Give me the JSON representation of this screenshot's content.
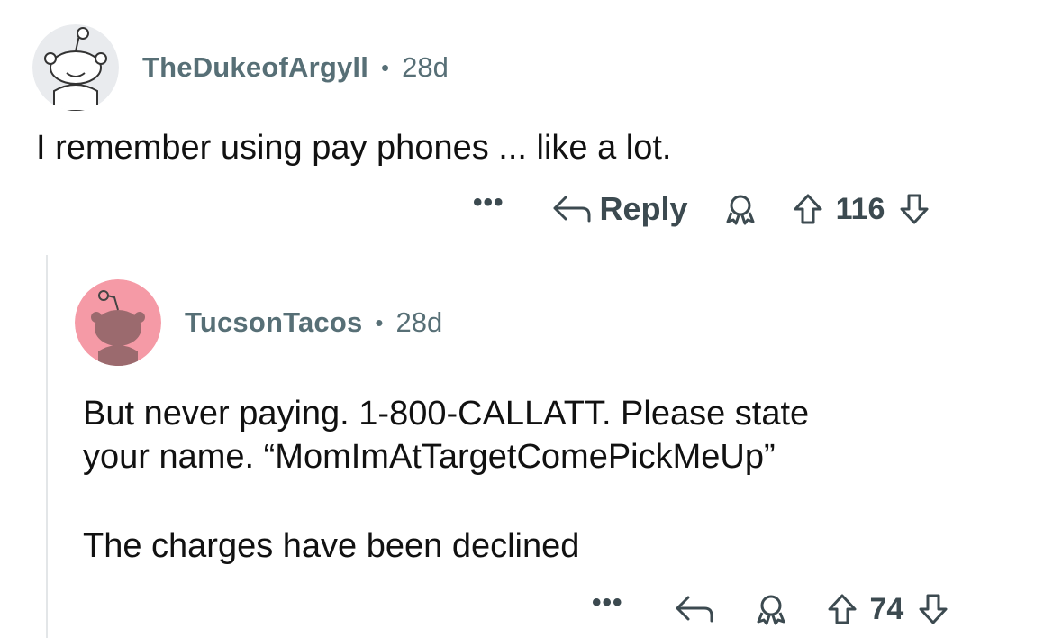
{
  "comments": [
    {
      "username": "TheDukeofArgyll",
      "separator": "•",
      "age": "28d",
      "lines": [
        "I remember using pay phones ... like a lot."
      ],
      "more": "•••",
      "reply_label": "Reply",
      "score": "116",
      "avatar_color": "#e9ebee"
    },
    {
      "username": "TucsonTacos",
      "separator": "•",
      "age": "28d",
      "lines": [
        "But never paying. 1-800-CALLATT. Please state",
        "your name. “MomImAtTargetComePickMeUp”",
        "The charges have been declined"
      ],
      "more": "•••",
      "score": "74",
      "avatar_color": "#f59aa6"
    }
  ]
}
